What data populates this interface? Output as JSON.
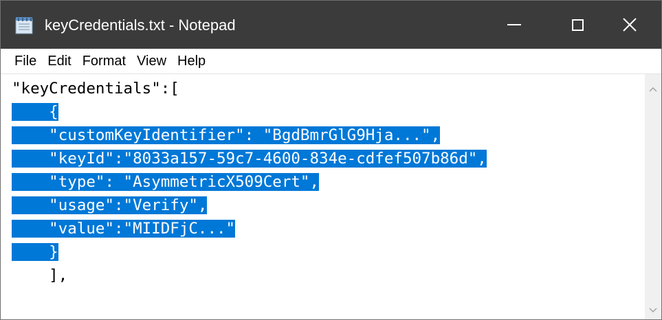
{
  "window": {
    "title": "keyCredentials.txt - Notepad",
    "icon": "notepad-icon"
  },
  "menu": {
    "items": [
      "File",
      "Edit",
      "Format",
      "View",
      "Help"
    ]
  },
  "editor": {
    "lines": [
      "\"keyCredentials\":[",
      "    {",
      "    \"customKeyIdentifier\": \"BgdBmrGlG9Hja...\",",
      "    \"keyId\":\"8033a157-59c7-4600-834e-cdfef507b86d\",",
      "    \"type\": \"AsymmetricX509Cert\",",
      "    \"usage\":\"Verify\",",
      "    \"value\":\"MIIDFjC...\"",
      "    }",
      "    ],"
    ],
    "selected_lines": [
      1,
      2,
      3,
      4,
      5,
      6,
      7
    ],
    "selection_color": "#0078d7"
  },
  "colors": {
    "titlebar": "#3b3b3b",
    "selection": "#0078d7"
  }
}
